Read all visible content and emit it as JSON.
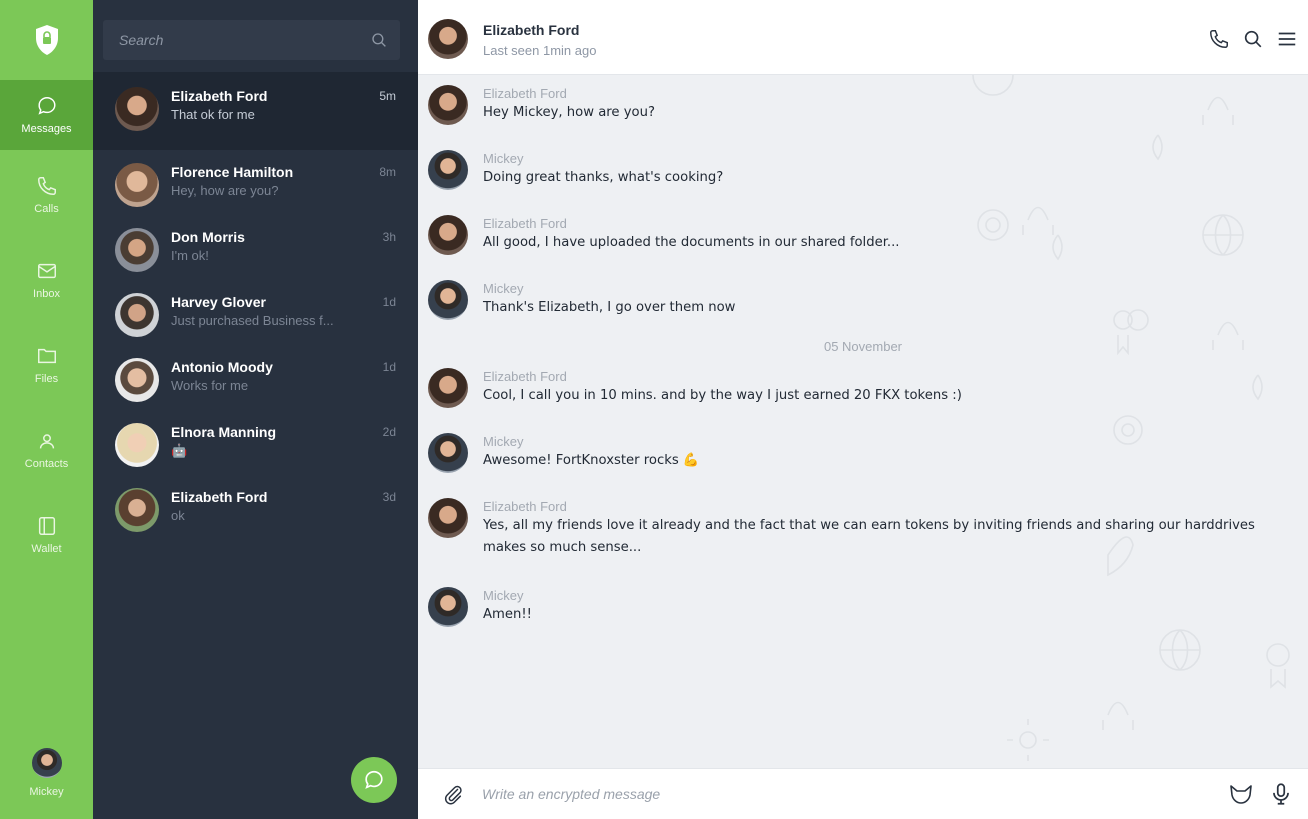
{
  "colors": {
    "accent": "#7cc857",
    "accent_dark": "#5aa63a",
    "sidebar": "#28313f",
    "chat_bg": "#eef0f3"
  },
  "nav": {
    "logo_icon": "shield-lock-icon",
    "items": [
      {
        "label": "Messages",
        "icon": "chat-bubble-icon"
      },
      {
        "label": "Calls",
        "icon": "phone-icon"
      },
      {
        "label": "Inbox",
        "icon": "envelope-icon"
      },
      {
        "label": "Files",
        "icon": "folder-icon"
      },
      {
        "label": "Contacts",
        "icon": "person-icon"
      },
      {
        "label": "Wallet",
        "icon": "wallet-icon"
      }
    ],
    "user": {
      "name": "Mickey"
    }
  },
  "search": {
    "placeholder": "Search"
  },
  "conversations": [
    {
      "name": "Elizabeth Ford",
      "preview": "That ok for me",
      "time": "5m"
    },
    {
      "name": "Florence Hamilton",
      "preview": "Hey, how are you?",
      "time": "8m"
    },
    {
      "name": "Don Morris",
      "preview": "I'm ok!",
      "time": "3h"
    },
    {
      "name": "Harvey Glover",
      "preview": "Just purchased Business f...",
      "time": "1d"
    },
    {
      "name": "Antonio Moody",
      "preview": "Works for me",
      "time": "1d"
    },
    {
      "name": "Elnora Manning",
      "preview": "🤖",
      "time": "2d"
    },
    {
      "name": "Elizabeth Ford",
      "preview": "ok",
      "time": "3d"
    }
  ],
  "chat": {
    "contact": {
      "name": "Elizabeth Ford",
      "status": "Last seen 1min ago"
    },
    "messages": [
      {
        "sender": "Elizabeth Ford",
        "text": "Hey Mickey, how are you?"
      },
      {
        "sender": "Mickey",
        "text": "Doing great thanks, what's cooking?"
      },
      {
        "sender": "Elizabeth Ford",
        "text": "All good, I have uploaded the documents in our shared folder..."
      },
      {
        "sender": "Mickey",
        "text": "Thank's Elizabeth, I go over them now"
      },
      {
        "sender": "Elizabeth Ford",
        "text": "Cool, I call you in 10 mins. and by the way I just earned 20 FKX tokens :)"
      },
      {
        "sender": "Mickey",
        "text": "Awesome! FortKnoxster rocks 💪"
      },
      {
        "sender": "Elizabeth Ford",
        "text": "Yes, all my friends love it already and the fact that we can earn tokens by inviting friends and sharing our harddrives makes so much sense..."
      },
      {
        "sender": "Mickey",
        "text": "Amen!!"
      }
    ],
    "date_separator": "05 November",
    "composer_placeholder": "Write an encrypted message"
  }
}
